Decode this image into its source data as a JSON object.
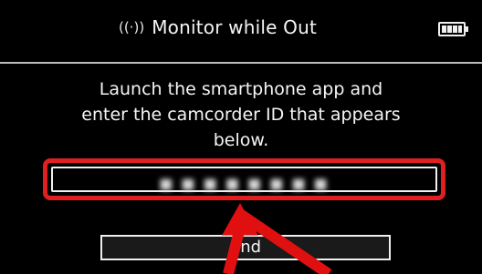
{
  "header": {
    "title": "Monitor while Out",
    "wifi_icon": "wifi-signal-icon",
    "battery_icon": "battery-icon"
  },
  "instructions": {
    "line1": "Launch the smartphone app and",
    "line2": "enter the camcorder ID that appears",
    "line3": "below."
  },
  "camcorder_id": {
    "value": "■ ■ ■ ■ ■ ■ ■ ■"
  },
  "buttons": {
    "end_label": "End"
  },
  "colors": {
    "highlight": "#e02020",
    "background": "#000000"
  }
}
